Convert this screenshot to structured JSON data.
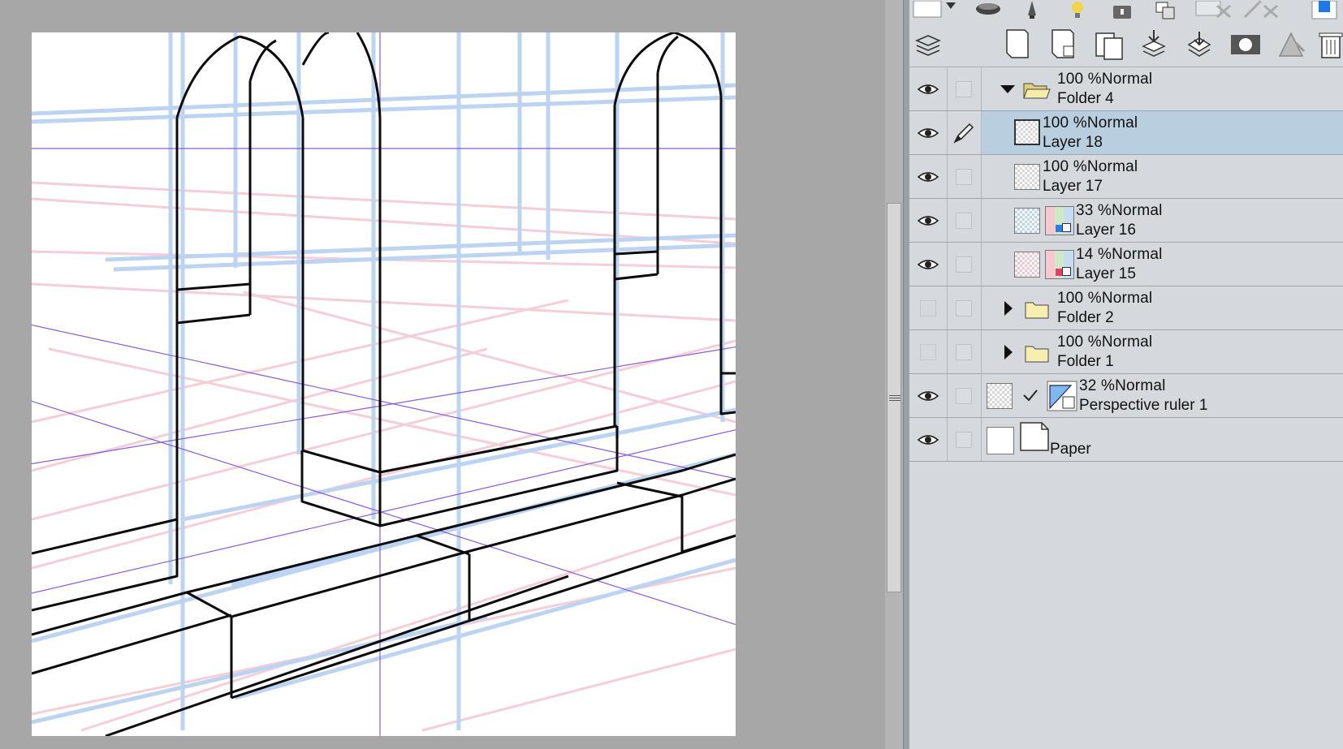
{
  "app": {
    "accent": "#b9cfe0"
  },
  "layers": [
    {
      "opacity": "100 %Normal",
      "name": "Folder 4",
      "kind": "folder",
      "expanded": true,
      "visible": true
    },
    {
      "opacity": "100 %Normal",
      "name": "Layer 18",
      "kind": "raster",
      "visible": true,
      "selected": true,
      "editing": true
    },
    {
      "opacity": "100 %Normal",
      "name": "Layer 17",
      "kind": "raster",
      "visible": true
    },
    {
      "opacity": "33 %Normal",
      "name": "Layer 16",
      "kind": "raster-mask-blue",
      "visible": true
    },
    {
      "opacity": "14 %Normal",
      "name": "Layer 15",
      "kind": "raster-mask-pink",
      "visible": true
    },
    {
      "opacity": "100 %Normal",
      "name": "Folder 2",
      "kind": "folder",
      "expanded": false,
      "visible": false
    },
    {
      "opacity": "100 %Normal",
      "name": "Folder 1",
      "kind": "folder",
      "expanded": false,
      "visible": false
    },
    {
      "opacity": "32 %Normal",
      "name": "Perspective ruler 1",
      "kind": "ruler",
      "visible": true
    },
    {
      "opacity": "",
      "name": "Paper",
      "kind": "paper",
      "visible": true
    }
  ],
  "icons": {
    "toolbar_top": [
      "color-swatch-icon",
      "cauldron-icon",
      "lamp-icon",
      "lightbulb-icon",
      "lock-icon",
      "layer-order-icon",
      "mask-delete-icon",
      "ruler-delete-icon",
      "color-icon"
    ],
    "toolbar_layer": [
      "layer-palette-icon",
      "new-raster-layer-icon",
      "new-vector-layer-icon",
      "new-folder-icon",
      "merge-down-icon",
      "merge-visible-icon",
      "create-mask-icon",
      "ruler-icon",
      "delete-layer-icon"
    ]
  }
}
